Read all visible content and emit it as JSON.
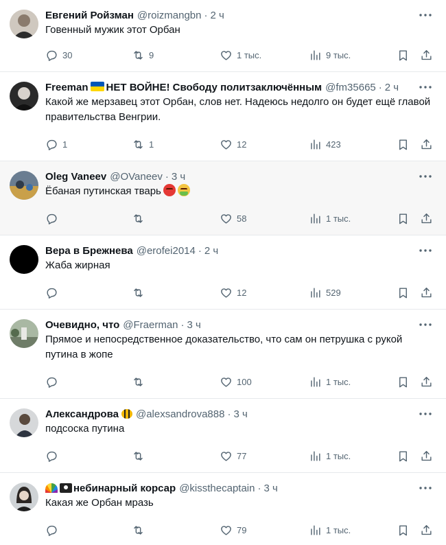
{
  "tweets": [
    {
      "name": "Евгений Ройзман",
      "handle": "@roizmangbn",
      "separator": "·",
      "time": "2 ч",
      "text": "Говенный мужик этот Орбан",
      "replies": "30",
      "retweets": "9",
      "likes": "1 тыс.",
      "views": "9 тыс."
    },
    {
      "name": "Freeman",
      "name_suffix": "НЕТ ВОЙНЕ! Свободу политзаключённым",
      "handle": "@fm35665",
      "separator": "·",
      "time": "2 ч",
      "text": "Какой же мерзавец этот Орбан, слов нет. Надеюсь недолго он будет ещё главой правительства Венгрии.",
      "replies": "1",
      "retweets": "1",
      "likes": "12",
      "views": "423"
    },
    {
      "name": "Oleg Vaneev",
      "handle": "@OVaneev",
      "separator": "·",
      "time": "3 ч",
      "text": "Ёбаная путинская тварь",
      "replies": "",
      "retweets": "",
      "likes": "58",
      "views": "1 тыс."
    },
    {
      "name": "Вера в Брежнева",
      "handle": "@erofei2014",
      "separator": "·",
      "time": "2 ч",
      "text": "Жаба жирная",
      "replies": "",
      "retweets": "",
      "likes": "12",
      "views": "529"
    },
    {
      "name": "Очевидно, что",
      "handle": "@Fraerman",
      "separator": "·",
      "time": "3 ч",
      "text": "Прямое и непосредственное доказательство, что сам он петрушка с рукой путина в жопе",
      "replies": "",
      "retweets": "",
      "likes": "100",
      "views": "1 тыс."
    },
    {
      "name": "Александрова",
      "handle": "@alexsandrova888",
      "separator": "·",
      "time": "3 ч",
      "text": "подсоска путина",
      "replies": "",
      "retweets": "",
      "likes": "77",
      "views": "1 тыс."
    },
    {
      "name": "небинарный корсар",
      "handle": "@kissthecaptain",
      "separator": "·",
      "time": "3 ч",
      "text": "Какая же Орбан мразь",
      "replies": "",
      "retweets": "",
      "likes": "79",
      "views": "1 тыс."
    }
  ],
  "icons": {
    "reply": "reply-icon",
    "retweet": "retweet-icon",
    "like": "heart-icon",
    "views": "views-icon",
    "bookmark": "bookmark-icon",
    "share": "share-icon",
    "more": "more-icon"
  },
  "colors": {
    "text": "#0f1419",
    "secondary": "#536471",
    "border": "#e6e9ec",
    "highlight_bg": "#f7f7f7"
  }
}
